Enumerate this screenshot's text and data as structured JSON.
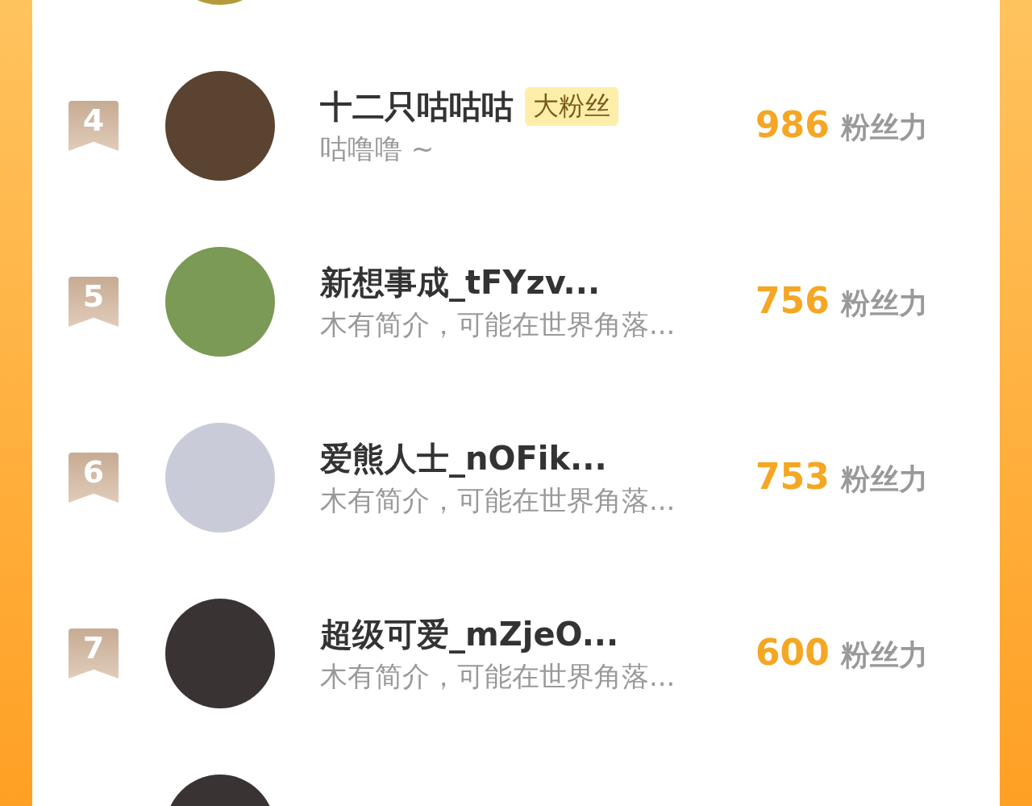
{
  "rows": [
    {
      "rank": "4",
      "name": "十二只咕咕咕",
      "badge": "大粉丝",
      "bio": "咕噜噜 ~",
      "score": "986",
      "unit": "粉丝力"
    },
    {
      "rank": "5",
      "name": "新想事成_tFYzv...",
      "bio": "木有简介，可能在世界角落...",
      "score": "756",
      "unit": "粉丝力"
    },
    {
      "rank": "6",
      "name": "爱熊人士_nOFik...",
      "bio": "木有简介，可能在世界角落...",
      "score": "753",
      "unit": "粉丝力"
    },
    {
      "rank": "7",
      "name": "超级可爱_mZjeO...",
      "bio": "木有简介，可能在世界角落...",
      "score": "600",
      "unit": "粉丝力"
    }
  ]
}
